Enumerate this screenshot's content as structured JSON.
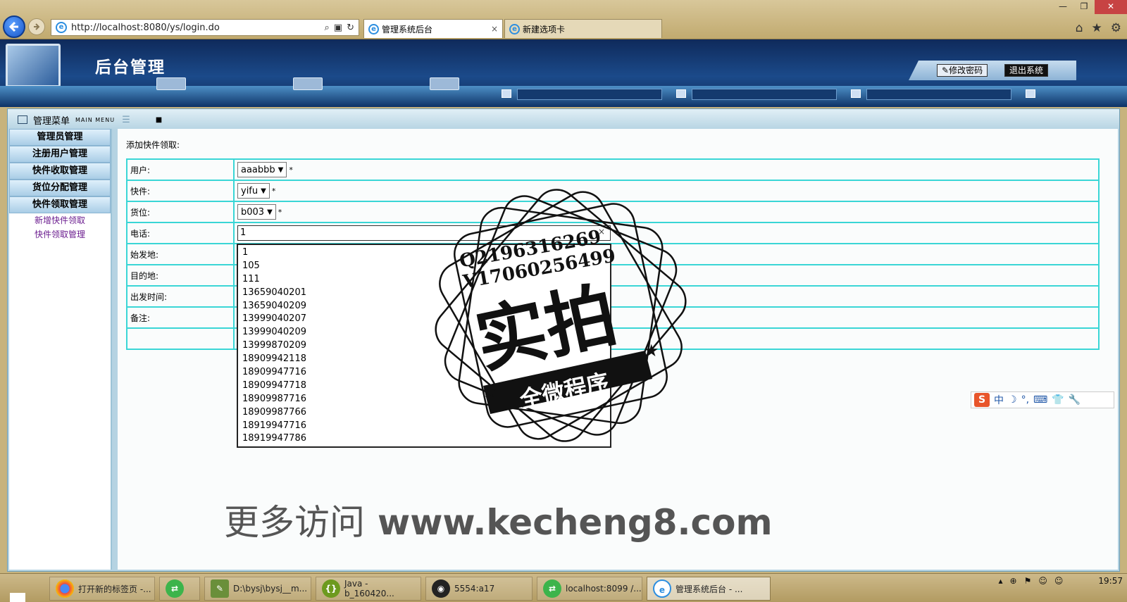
{
  "browser": {
    "url": "http://localhost:8080/ys/login.do",
    "tabs": [
      {
        "label": "管理系统后台",
        "active": true
      },
      {
        "label": "新建选项卡",
        "active": false
      }
    ]
  },
  "header": {
    "title": "后台管理",
    "change_password": "修改密码",
    "logout": "退出系统"
  },
  "menu": {
    "title": "管理菜单",
    "title_en": "MAIN MENU",
    "sections": [
      {
        "label": "管理员管理"
      },
      {
        "label": "注册用户管理"
      },
      {
        "label": "快件收取管理"
      },
      {
        "label": "货位分配管理"
      },
      {
        "label": "快件领取管理"
      }
    ],
    "subitems": [
      {
        "label": "新增快件领取"
      },
      {
        "label": "快件领取管理"
      }
    ]
  },
  "form": {
    "title": "添加快件领取:",
    "required_mark": "*",
    "fields": [
      {
        "label": "用户:",
        "type": "select",
        "value": "aaabbb"
      },
      {
        "label": "快件:",
        "type": "select",
        "value": "yifu"
      },
      {
        "label": "货位:",
        "type": "select",
        "value": "b003"
      },
      {
        "label": "电话:",
        "type": "input",
        "value": "1"
      },
      {
        "label": "始发地:",
        "type": "input",
        "value": ""
      },
      {
        "label": "目的地:",
        "type": "input",
        "value": ""
      },
      {
        "label": "出发时间:",
        "type": "input",
        "value": ""
      },
      {
        "label": "备注:",
        "type": "input",
        "value": ""
      }
    ],
    "autocomplete": [
      "1",
      "105",
      "111",
      "13659040201",
      "13659040209",
      "13999040207",
      "13999040209",
      "13999870209",
      "18909942118",
      "18909947716",
      "18909947718",
      "18909987716",
      "18909987766",
      "18919947716",
      "18919947786"
    ]
  },
  "watermark": {
    "qq": "Q2196316269",
    "v": "V17060256499",
    "main": "实拍",
    "banner": "全微程序"
  },
  "promo": {
    "prefix": "更多访问",
    "site": "www.kecheng8.com"
  },
  "ime": {
    "mode": "中"
  },
  "taskbar": {
    "items": [
      {
        "label": "打开新的标签页 -..."
      },
      {
        "label": ""
      },
      {
        "label": "D:\\bysj\\bysj__m..."
      },
      {
        "label": "Java - b_160420..."
      },
      {
        "label": "5554:a17"
      },
      {
        "label": "localhost:8099 /..."
      },
      {
        "label": "管理系统后台 - ..."
      }
    ],
    "clock": "19:57"
  }
}
